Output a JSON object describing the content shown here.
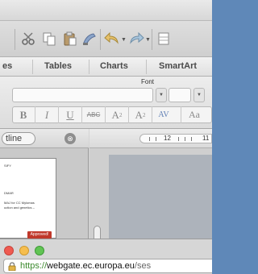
{
  "ribbon": {
    "tabs": [
      "es",
      "Tables",
      "Charts",
      "SmartArt"
    ],
    "font_group_label": "Font"
  },
  "format_buttons": {
    "bold": "B",
    "italic": "I",
    "underline": "U",
    "strikethrough": "ABC",
    "superscript": "A",
    "superscript_mark": "2",
    "subscript": "A",
    "subscript_mark": "2",
    "spacing": "AV",
    "case": "Aa"
  },
  "sidebar": {
    "outline_label": "tline",
    "close_glyph": "⊗",
    "thumbnail": {
      "line1": "SIFY",
      "line2": "DMAR",
      "line3": "MAJ for CC Mylomas",
      "line4": "uction and genetics –",
      "badge": "Approved!"
    }
  },
  "ruler": {
    "n1": "12",
    "n2": "11"
  },
  "browser": {
    "url_scheme": "https://",
    "url_host": "webgate.ec.europa.eu",
    "url_path": "/ses"
  },
  "colors": {
    "close": "#ef5a51",
    "minimize": "#f6be4f",
    "zoom": "#61c454",
    "approved_badge": "#c0392b",
    "desktop": "#5f88b8"
  }
}
